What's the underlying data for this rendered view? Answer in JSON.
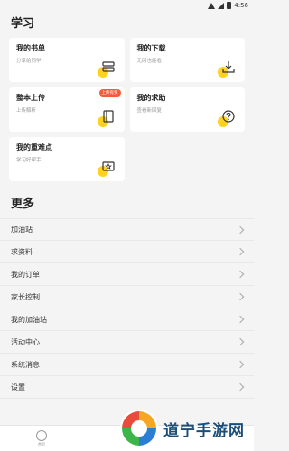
{
  "status_bar": {
    "time": "4:56"
  },
  "study": {
    "title": "学习",
    "cards": [
      {
        "title": "我的书单",
        "subtitle": "分享给同学",
        "icon": "book-list-icon"
      },
      {
        "title": "我的下载",
        "subtitle": "无网也能看",
        "icon": "download-icon"
      },
      {
        "title": "整本上传",
        "subtitle": "上传解析",
        "icon": "upload-book-icon",
        "badge": "上传有奖"
      },
      {
        "title": "我的求助",
        "subtitle": "查看新回复",
        "icon": "question-icon"
      },
      {
        "title": "我的重难点",
        "subtitle": "学习好帮手",
        "icon": "star-board-icon"
      }
    ]
  },
  "more": {
    "title": "更多",
    "items": [
      {
        "label": "加油站"
      },
      {
        "label": "求资料"
      },
      {
        "label": "我的订单"
      },
      {
        "label": "家长控制"
      },
      {
        "label": "我的加油站"
      },
      {
        "label": "活动中心"
      },
      {
        "label": "系统消息"
      },
      {
        "label": "设置"
      }
    ]
  },
  "tabbar": {
    "home_label": "首页"
  },
  "watermark": {
    "text": "道宁手游网"
  },
  "colors": {
    "accent": "#ffd21f",
    "badge": "#f25c3d",
    "watermark_text": "#1a4d7a"
  }
}
